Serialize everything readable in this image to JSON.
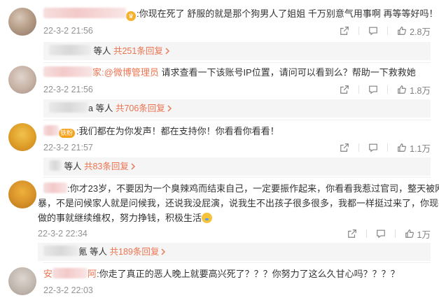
{
  "comments": [
    {
      "user_suffix": "",
      "text": ":你现在死了 舒服的就是那个狗男人了姐姐 千万别意气用事啊 再等等好吗！！",
      "date": "22-3-2 21:56",
      "likes": "2.8万",
      "reply_suffix": "等人",
      "reply_count": "共251条回复"
    },
    {
      "user_suffix": "家",
      "mention": ":@微博管理员",
      "text": " 请求查看一下该账号IP位置，请问可以看到么？帮助一下救救她",
      "date": "22-3-2 21:56",
      "likes": "1.8万",
      "reply_name_suffix": "a",
      "reply_suffix": "等人",
      "reply_count": "共706条回复"
    },
    {
      "badge": "铁粉",
      "text": ":我们都在为你发声！都在支持你！你看看你看看！",
      "date": "22-3-2 21:57",
      "likes": "1.1万",
      "reply_suffix": "等人",
      "reply_count": "共83条回复"
    },
    {
      "text_lines": [
        ":你才23岁，不要因为一个臭辣鸡而结束自己，一定要振作起来，你看看我惹过官司，整天被网",
        "暴，不是问候家人就是问候我，还说我没屁演，说我生不出孩子很多很多，我都一样挺过来了，你现在要",
        "做的事就继续维权，努力挣钱，积极生活"
      ],
      "date": "22-3-2 22:34",
      "likes": "1万",
      "reply_name_suffix": "氪",
      "reply_suffix": "等人",
      "reply_count": "共189条回复"
    },
    {
      "user_prefix": "安",
      "user_suffix": "阿",
      "text": ":你走了真正的恶人晚上就要高兴死了？？？你努力了这么久甘心吗？？？？",
      "date": "22-3-2 22:03"
    }
  ],
  "icons": {
    "share": "share-icon",
    "comment": "comment-icon",
    "like": "thumb-up-icon",
    "chevron": "chevron-right-icon"
  },
  "colors": {
    "accent": "#eb7350",
    "meta": "#939393",
    "reply_bg": "#f5f5f5"
  }
}
